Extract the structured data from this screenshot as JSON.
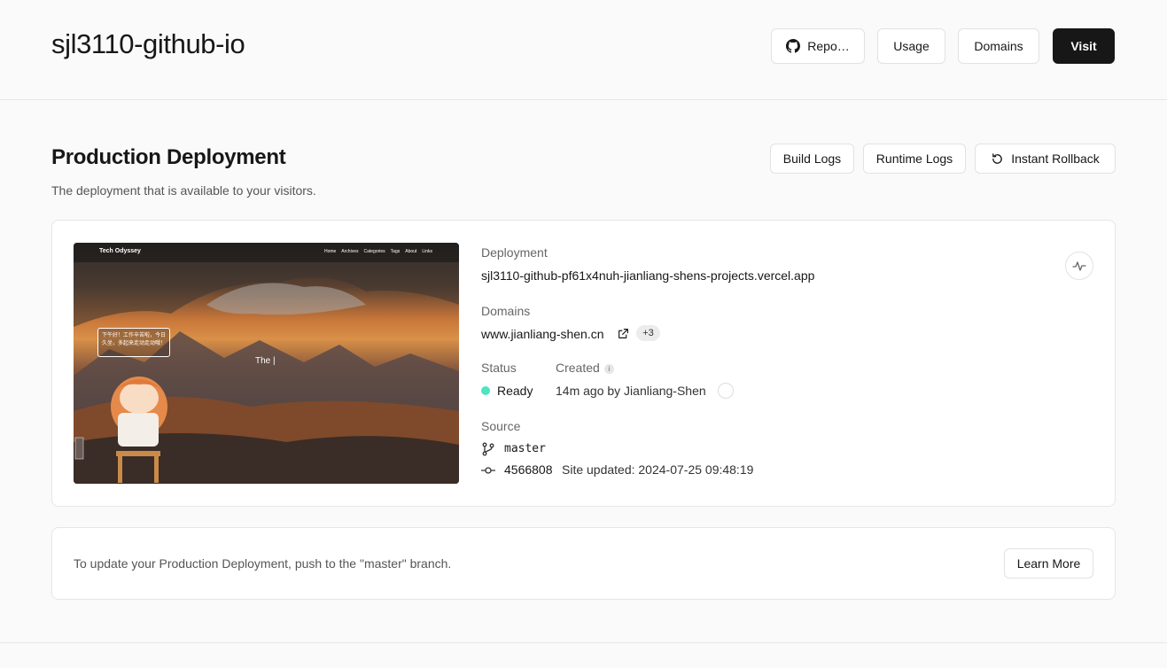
{
  "header": {
    "title": "sjl3110-github-io",
    "repo_label": "Repo…",
    "usage_label": "Usage",
    "domains_label": "Domains",
    "visit_label": "Visit"
  },
  "production": {
    "title": "Production Deployment",
    "subtitle": "The deployment that is available to your visitors.",
    "build_logs": "Build Logs",
    "runtime_logs": "Runtime Logs",
    "rollback": "Instant Rollback"
  },
  "preview": {
    "brand": "Tech Odyssey",
    "nav": [
      "Home",
      "Archives",
      "Categories",
      "Tags",
      "About",
      "Links"
    ],
    "bubble": "下午好！工作辛苦啦，今日久坐，多起来走动走动哦！",
    "typing": "The |"
  },
  "deployment": {
    "label": "Deployment",
    "url": "sjl3110-github-pf61x4nuh-jianliang-shens-projects.vercel.app",
    "domains_label": "Domains",
    "domain": "www.jianliang-shen.cn",
    "domains_extra": "+3",
    "status_label": "Status",
    "status": "Ready",
    "created_label": "Created",
    "created": "14m ago by Jianliang-Shen",
    "source_label": "Source",
    "branch": "master",
    "commit": "4566808",
    "commit_msg": "Site updated: 2024-07-25 09:48:19"
  },
  "colors": {
    "status_ready": "#50e3c2",
    "primary": "#171717"
  },
  "notice": {
    "text": "To update your Production Deployment, push to the \"master\" branch.",
    "learn_more": "Learn More"
  }
}
